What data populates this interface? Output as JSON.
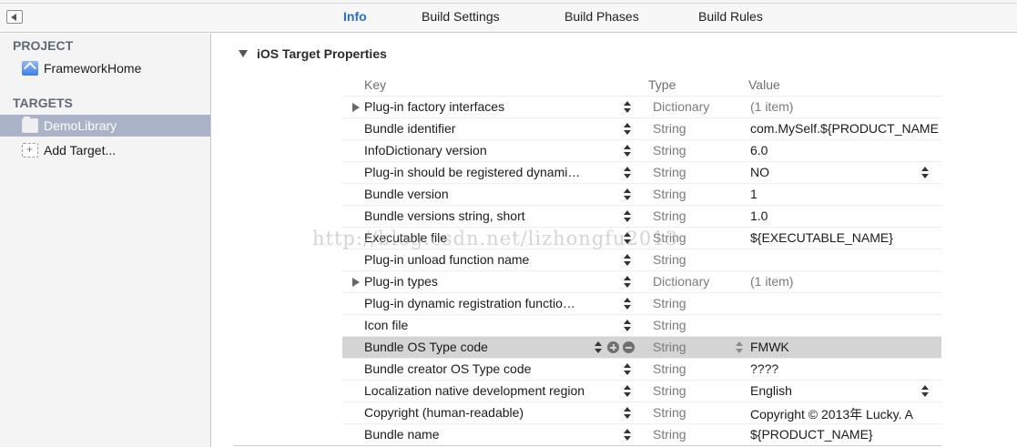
{
  "tabs": [
    {
      "label": "Info",
      "active": true
    },
    {
      "label": "Build Settings",
      "active": false
    },
    {
      "label": "Build Phases",
      "active": false
    },
    {
      "label": "Build Rules",
      "active": false
    }
  ],
  "sidebar": {
    "project_header": "PROJECT",
    "project_item": "FrameworkHome",
    "targets_header": "TARGETS",
    "target_item": "DemoLibrary",
    "add_target": "Add Target..."
  },
  "main": {
    "section_title": "iOS Target Properties",
    "columns": {
      "key": "Key",
      "type": "Type",
      "value": "Value"
    },
    "rows": [
      {
        "key": "Plug-in factory interfaces",
        "type": "Dictionary",
        "value": "(1 item)"
      },
      {
        "key": "Bundle identifier",
        "type": "String",
        "value": "com.MySelf.${PRODUCT_NAME"
      },
      {
        "key": "InfoDictionary version",
        "type": "String",
        "value": "6.0"
      },
      {
        "key": "Plug-in should be registered dynami…",
        "type": "String",
        "value": "NO"
      },
      {
        "key": "Bundle version",
        "type": "String",
        "value": "1"
      },
      {
        "key": "Bundle versions string, short",
        "type": "String",
        "value": "1.0"
      },
      {
        "key": "Executable file",
        "type": "String",
        "value": "${EXECUTABLE_NAME}"
      },
      {
        "key": "Plug-in unload function name",
        "type": "String",
        "value": ""
      },
      {
        "key": "Plug-in types",
        "type": "Dictionary",
        "value": "(1 item)"
      },
      {
        "key": "Plug-in dynamic registration functio…",
        "type": "String",
        "value": ""
      },
      {
        "key": "Icon file",
        "type": "String",
        "value": ""
      },
      {
        "key": "Bundle OS Type code",
        "type": "String",
        "value": "FMWK"
      },
      {
        "key": "Bundle creator OS Type code",
        "type": "String",
        "value": "????"
      },
      {
        "key": "Localization native development region",
        "type": "String",
        "value": "English"
      },
      {
        "key": "Copyright (human-readable)",
        "type": "String",
        "value": "Copyright © 2013年 Lucky. A"
      },
      {
        "key": "Bundle name",
        "type": "String",
        "value": "${PRODUCT_NAME}"
      }
    ]
  },
  "watermark": "http://blog.csdn.net/lizhongfu2013",
  "colors": {
    "accent": "#2a6fcf",
    "selection": "#aab3c7",
    "row_selected": "#d4d4d4"
  }
}
